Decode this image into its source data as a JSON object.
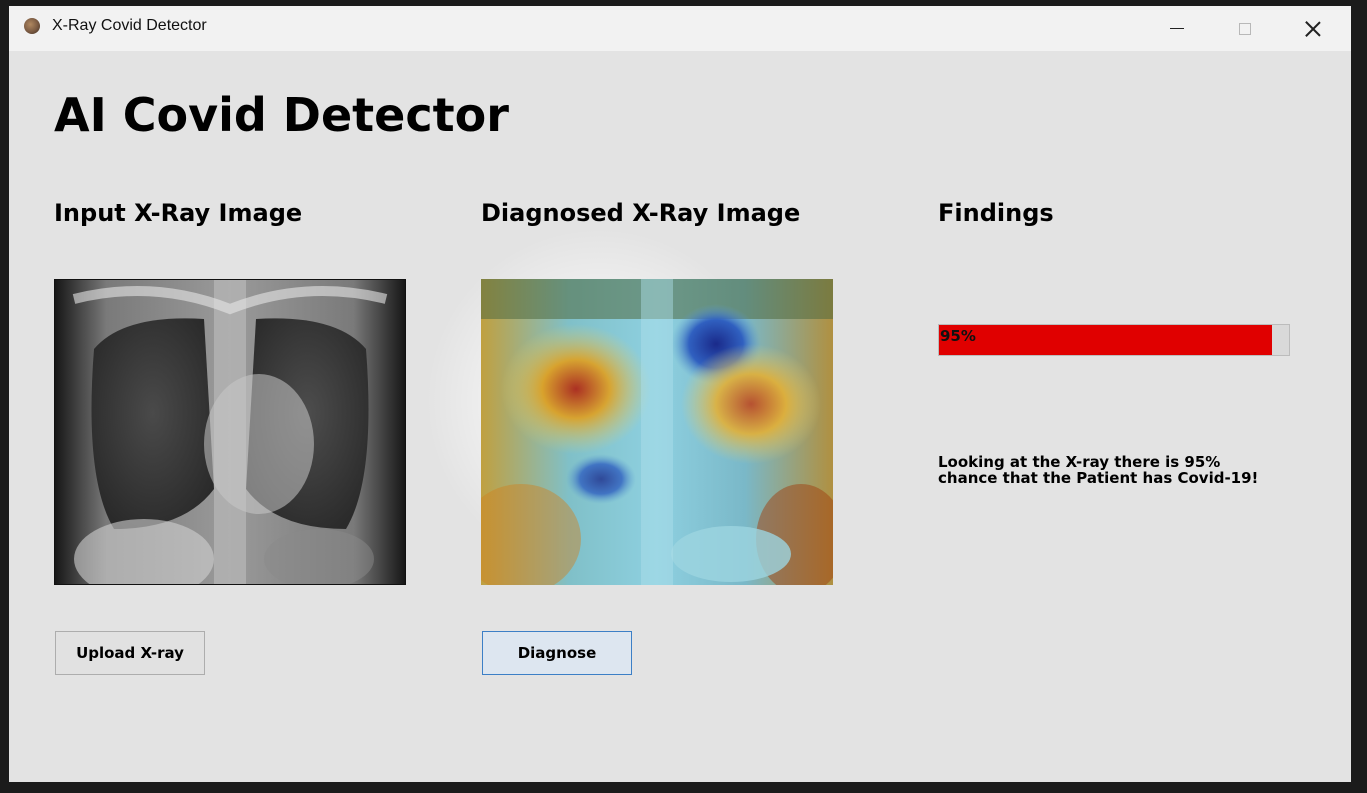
{
  "window": {
    "title": "X-Ray Covid Detector",
    "controls": {
      "minimize": "minimize",
      "maximize": "maximize",
      "close": "close"
    }
  },
  "app": {
    "heading": "AI Covid Detector"
  },
  "sections": {
    "input_title": "Input X-Ray Image",
    "diagnosed_title": "Diagnosed  X-Ray Image",
    "findings_title": "Findings"
  },
  "findings": {
    "probability_percent": 95,
    "probability_label": "95%",
    "bar_color": "#e00000",
    "message": "Looking at the X-ray there is 95%\nchance that the Patient has Covid-19!"
  },
  "buttons": {
    "upload": "Upload X-ray",
    "diagnose": "Diagnose"
  }
}
